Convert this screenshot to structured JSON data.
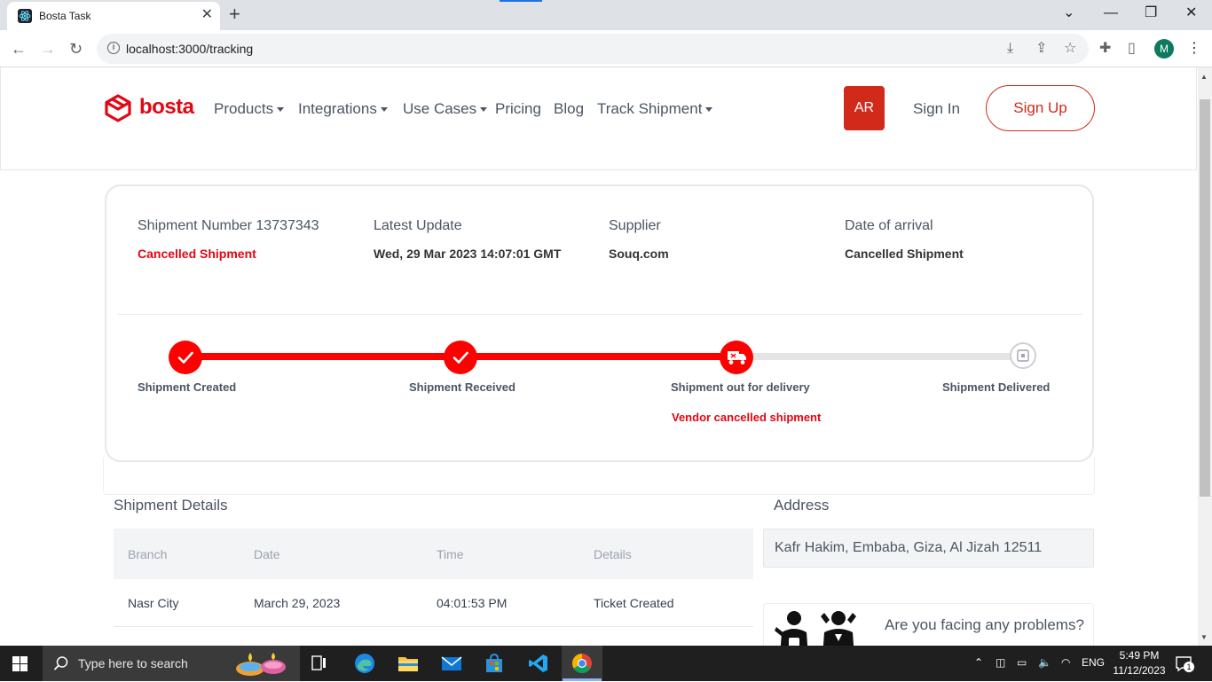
{
  "browser": {
    "tab_title": "Bosta Task",
    "url": "localhost:3000/tracking",
    "profile_initial": "M"
  },
  "header": {
    "logo_text": "bosta",
    "nav": [
      {
        "label": "Products",
        "dropdown": true
      },
      {
        "label": "Integrations",
        "dropdown": true
      },
      {
        "label": "Use Cases",
        "dropdown": true
      },
      {
        "label": "Pricing",
        "dropdown": false
      },
      {
        "label": "Blog",
        "dropdown": false
      },
      {
        "label": "Track Shipment",
        "dropdown": true
      }
    ],
    "lang_button": "AR",
    "sign_in": "Sign In",
    "sign_up": "Sign Up"
  },
  "shipment": {
    "number_label": "Shipment Number 13737343",
    "status": "Cancelled Shipment",
    "latest_update_label": "Latest Update",
    "latest_update_value": "Wed, 29 Mar 2023 14:07:01 GMT",
    "supplier_label": "Supplier",
    "supplier_value": "Souq.com",
    "arrival_label": "Date of arrival",
    "arrival_value": "Cancelled Shipment"
  },
  "progress": {
    "steps": [
      {
        "label": "Shipment Created",
        "state": "done"
      },
      {
        "label": "Shipment Received",
        "state": "done"
      },
      {
        "label": "Shipment out for delivery",
        "state": "current"
      },
      {
        "label": "Shipment Delivered",
        "state": "pending"
      }
    ],
    "reason": "Vendor cancelled shipment"
  },
  "details": {
    "title": "Shipment Details",
    "columns": [
      "Branch",
      "Date",
      "Time",
      "Details"
    ],
    "rows": [
      [
        "Nasr City",
        "March 29, 2023",
        "04:01:53 PM",
        "Ticket Created"
      ]
    ]
  },
  "address": {
    "title": "Address",
    "value": "Kafr Hakim, Embaba, Giza, Al Jizah 12511"
  },
  "help": {
    "text": "Are you facing any problems?"
  },
  "taskbar": {
    "search_placeholder": "Type here to search",
    "lang": "ENG",
    "time": "5:49 PM",
    "date": "11/12/2023",
    "notification_count": "1"
  },
  "colors": {
    "brand_red": "#e30613",
    "progress_red": "#ff0000"
  }
}
